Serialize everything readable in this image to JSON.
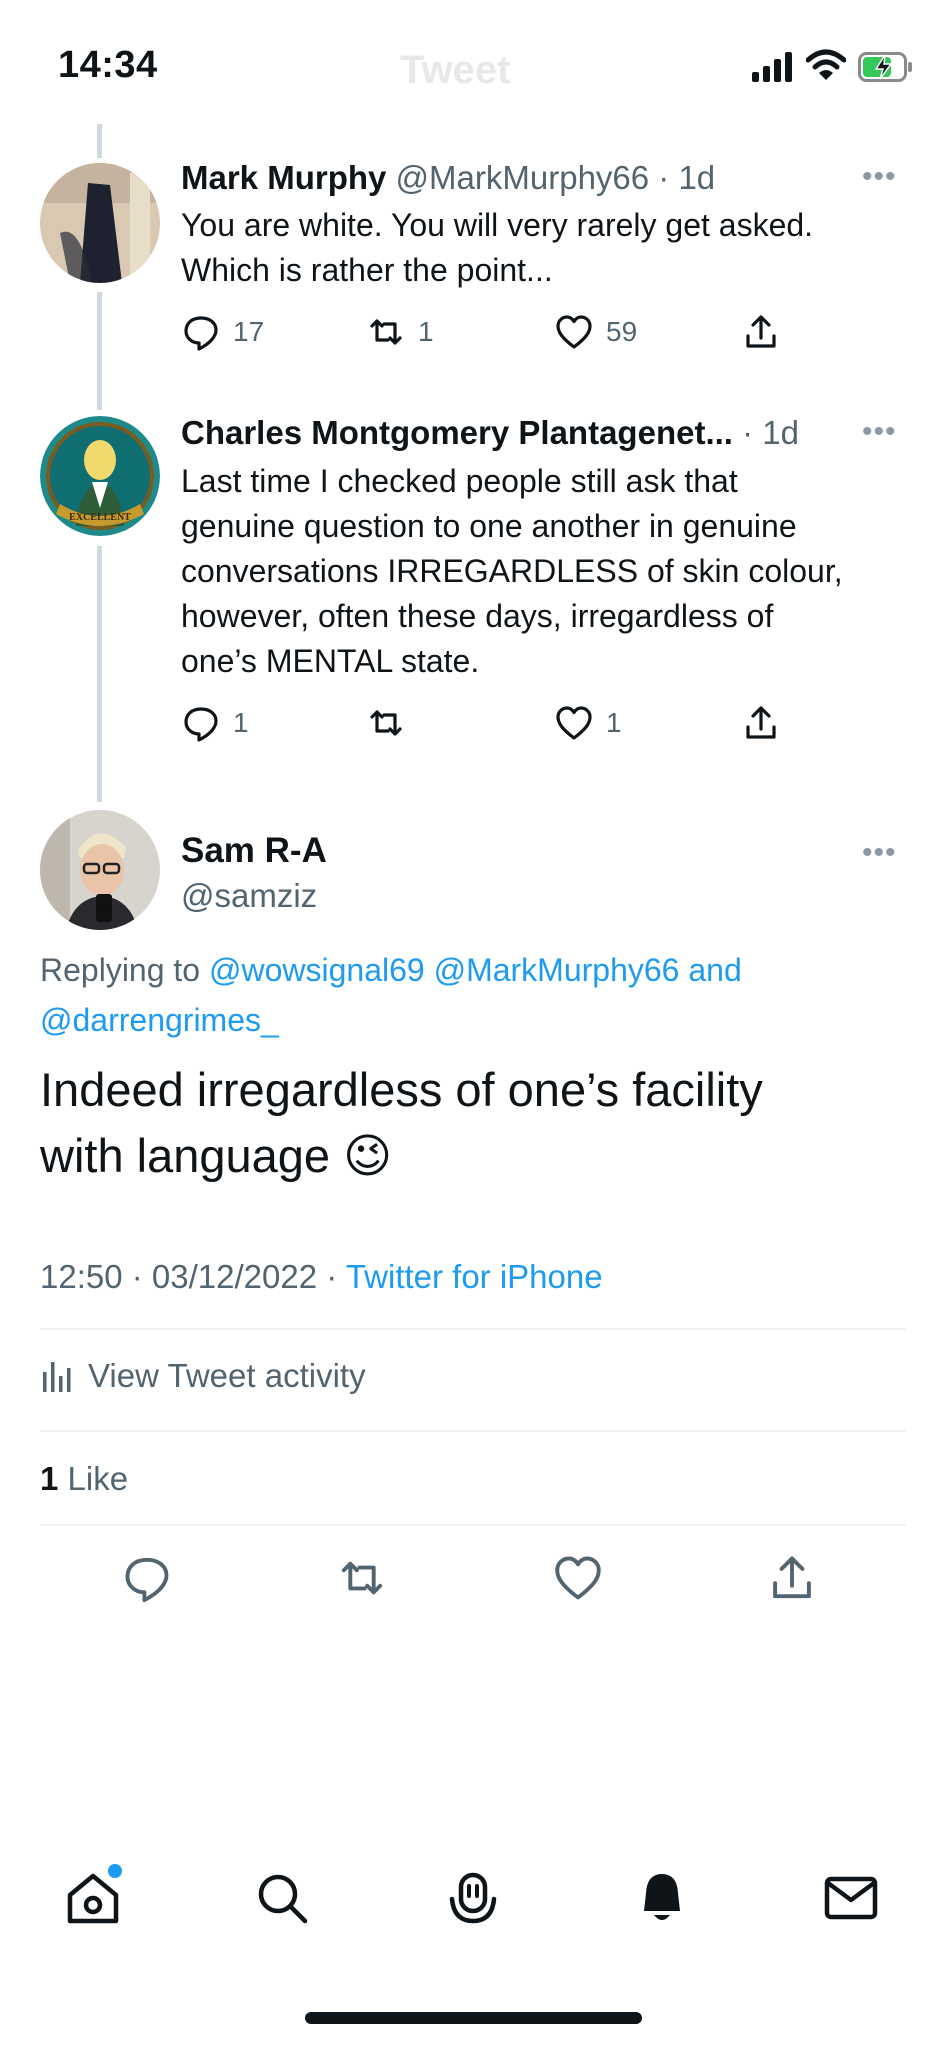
{
  "status": {
    "time": "14:34",
    "screen_title": "Tweet"
  },
  "thread": [
    {
      "name": "Mark Murphy",
      "handle": "@MarkMurphy66",
      "time": "· 1d",
      "text_lines": [
        "You are white. You will very rarely get asked.",
        "Which is rather the point..."
      ],
      "replies": "17",
      "retweets": "1",
      "likes": "59"
    },
    {
      "name": "Charles Montgomery Plantagenet...",
      "handle": "",
      "time": "· 1d",
      "avatar_badge": "EXCELLENT",
      "text_lines": [
        "Last time I checked people still ask that",
        "genuine question to one another in genuine",
        "conversations IRREGARDLESS of skin colour,",
        "however, often these days, irregardless of",
        "one’s MENTAL state."
      ],
      "replies": "1",
      "retweets": "",
      "likes": "1"
    }
  ],
  "main_tweet": {
    "name": "Sam R-A",
    "handle": "@samziz",
    "replying_to": "Replying to",
    "mentions": [
      "@wowsignal69",
      "@MarkMurphy66",
      "and",
      "@darrengrimes_"
    ],
    "text_lines": [
      "Indeed irregardless of one’s facility",
      "with language"
    ],
    "emoji": "😉",
    "timestamp": "12:50 · 03/12/2022 ·",
    "source": "Twitter for iPhone",
    "activity_label": "View Tweet activity",
    "like_count": "1",
    "like_label": "Like"
  },
  "tab_bar": [
    "home-icon",
    "search-icon",
    "spaces-icon",
    "notifications-icon",
    "messages-icon"
  ],
  "colors": {
    "accent": "#1d9bf0",
    "text": "#0f1419",
    "secondary": "#536471",
    "divider": "#eff3f4"
  }
}
